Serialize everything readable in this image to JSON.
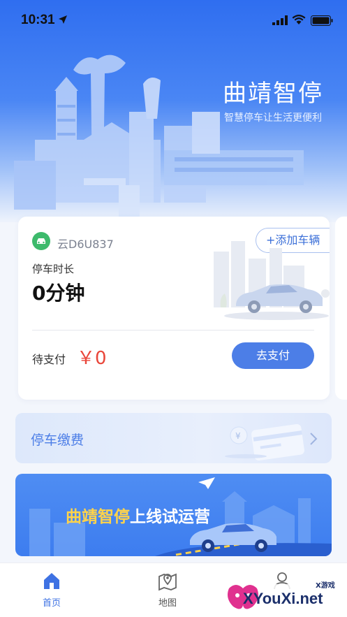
{
  "status_bar": {
    "time": "10:31"
  },
  "header": {
    "title": "曲靖智停",
    "subtitle": "智慧停车让生活更便利"
  },
  "parking_card": {
    "plate": "云D6U837",
    "add_vehicle_label": "+添加车辆",
    "duration_label": "停车时长",
    "duration_value": "0分钟",
    "pay_label": "待支付",
    "pay_amount": "￥0",
    "pay_button_label": "去支付"
  },
  "fee_banner": {
    "label": "停车缴费"
  },
  "promo_banner": {
    "title_highlight": "曲靖智停",
    "title_rest": "上线试运营"
  },
  "bottom_nav": {
    "items": [
      {
        "label": "首页",
        "icon": "home-icon",
        "active": true
      },
      {
        "label": "地图",
        "icon": "map-icon",
        "active": false
      },
      {
        "label": "",
        "icon": "profile-icon",
        "active": false
      }
    ]
  },
  "watermark": {
    "text": "XYouXi.net",
    "small": "X游戏"
  },
  "colors": {
    "accent": "#4c7ee7",
    "amount": "#e9463a",
    "plate_badge": "#3dba6c",
    "promo_highlight": "#ffd34a"
  }
}
